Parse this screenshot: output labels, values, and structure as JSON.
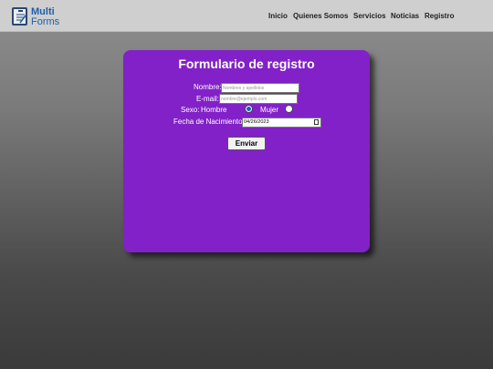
{
  "header": {
    "logo_line1": "Multi",
    "logo_line2": "Forms",
    "nav": [
      "Inicio",
      "Quienes Somos",
      "Servicios",
      "Noticias",
      "Registro"
    ]
  },
  "form": {
    "title": "Formulario de registro",
    "name_label": "Nombre:",
    "name_placeholder": "Nombres y apellidos",
    "email_label": "E-mail:",
    "email_placeholder": "nombre@ejemplo.com",
    "sex_label": "Sexo:",
    "option_male": "Hombre",
    "option_female": "Mujer",
    "selected_sex": "Hombre",
    "dob_label": "Fecha de Nacimiento:",
    "dob_value": "04/26/2023",
    "submit_label": "Enviar"
  },
  "colors": {
    "card": "#8221c7",
    "header": "#cfcfcf",
    "logo": "#1e5fa8"
  }
}
